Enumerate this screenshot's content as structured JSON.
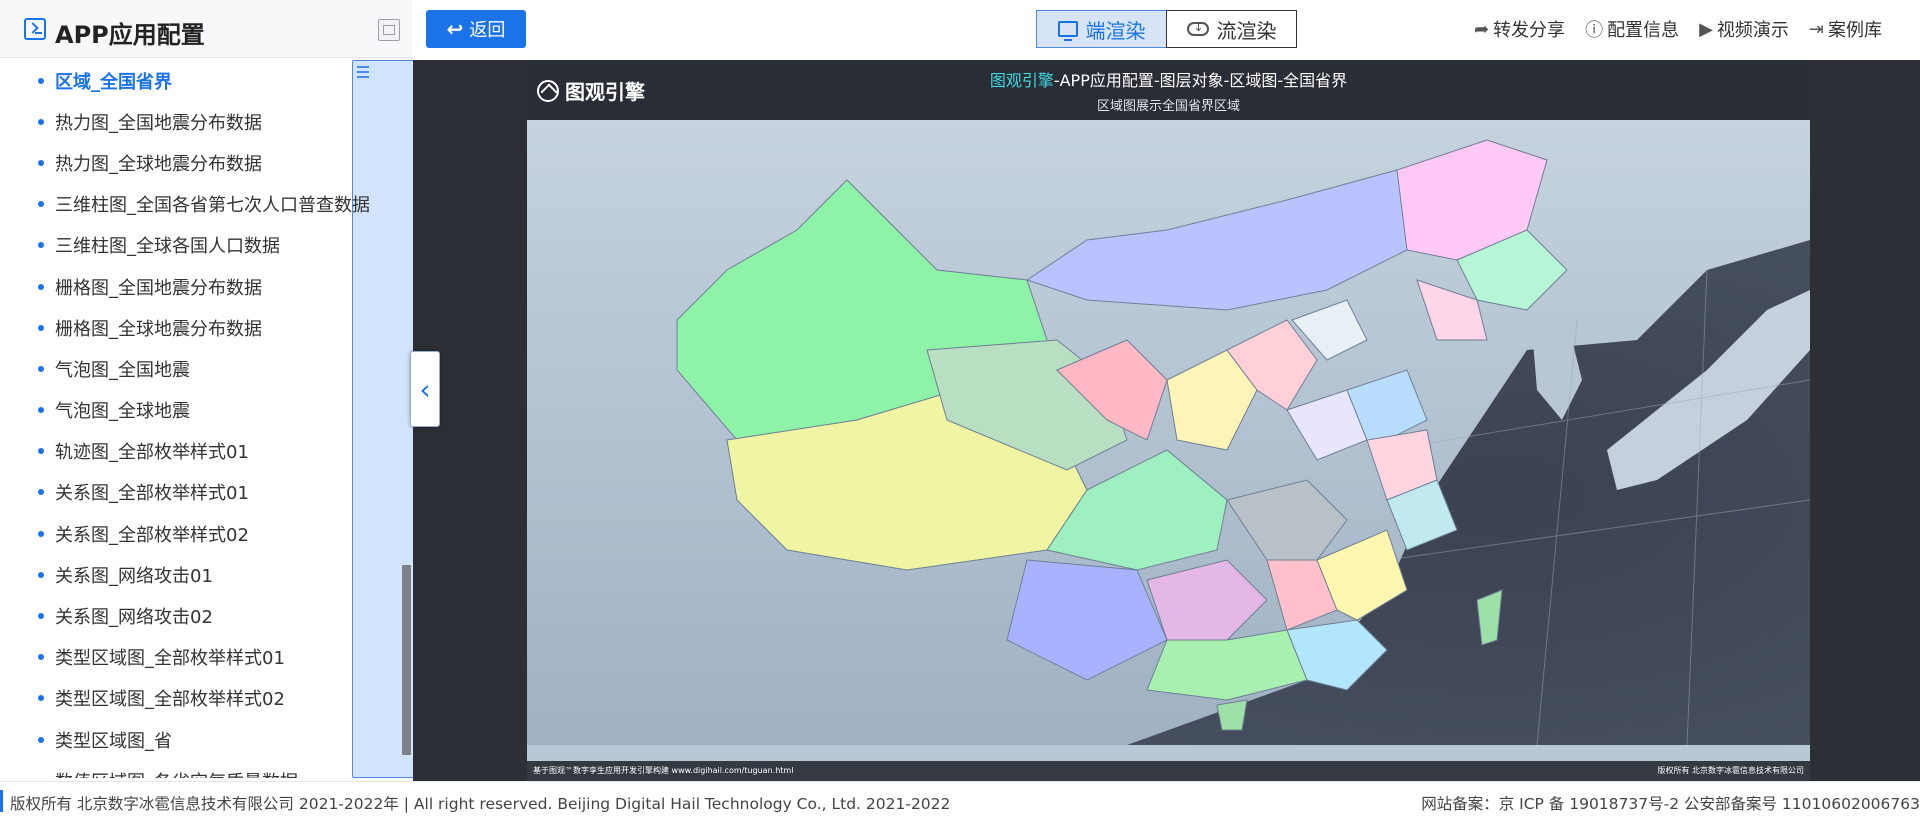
{
  "sidebar": {
    "title": "APP应用配置",
    "items": [
      {
        "label": "区域_全国省界",
        "active": true
      },
      {
        "label": "热力图_全国地震分布数据"
      },
      {
        "label": "热力图_全球地震分布数据"
      },
      {
        "label": "三维柱图_全国各省第七次人口普查数据"
      },
      {
        "label": "三维柱图_全球各国人口数据"
      },
      {
        "label": "栅格图_全国地震分布数据"
      },
      {
        "label": "栅格图_全球地震分布数据"
      },
      {
        "label": "气泡图_全国地震"
      },
      {
        "label": "气泡图_全球地震"
      },
      {
        "label": "轨迹图_全部枚举样式01"
      },
      {
        "label": "关系图_全部枚举样式01"
      },
      {
        "label": "关系图_全部枚举样式02"
      },
      {
        "label": "关系图_网络攻击01"
      },
      {
        "label": "关系图_网络攻击02"
      },
      {
        "label": "类型区域图_全部枚举样式01"
      },
      {
        "label": "类型区域图_全部枚举样式02"
      },
      {
        "label": "类型区域图_省"
      },
      {
        "label": "数值区域图_各省空气质量数据"
      }
    ]
  },
  "toolbar": {
    "back_label": "返回",
    "render_client": "端渲染",
    "render_stream": "流渲染",
    "links": [
      {
        "icon": "share-icon",
        "label": "转发分享"
      },
      {
        "icon": "info-icon",
        "label": "配置信息"
      },
      {
        "icon": "play-icon",
        "label": "视频演示"
      },
      {
        "icon": "library-icon",
        "label": "案例库"
      }
    ]
  },
  "map": {
    "brand": "图观引擎",
    "title_highlight": "图观引擎",
    "title_rest": "-APP应用配置-图层对象-区域图-全国省界",
    "subtitle": "区域图展示全国省界区域",
    "footer_left": "基于图观™数字孪生应用开发引擎构建 www.digihail.com/tuguan.html",
    "footer_right": "版权所有 北京数字冰雹信息技术有限公司"
  },
  "footer": {
    "copyright": "版权所有 北京数字冰雹信息技术有限公司 2021-2022年 | All right reserved. Beijing Digital Hail Technology Co., Ltd. 2021-2022",
    "icp": "网站备案：京 ICP 备 19018737号-2 公安部备案号 11010602006763"
  },
  "colors": {
    "accent": "#1a73e8",
    "stage": "#2c2f36",
    "map_title_highlight": "#41d9e0"
  }
}
